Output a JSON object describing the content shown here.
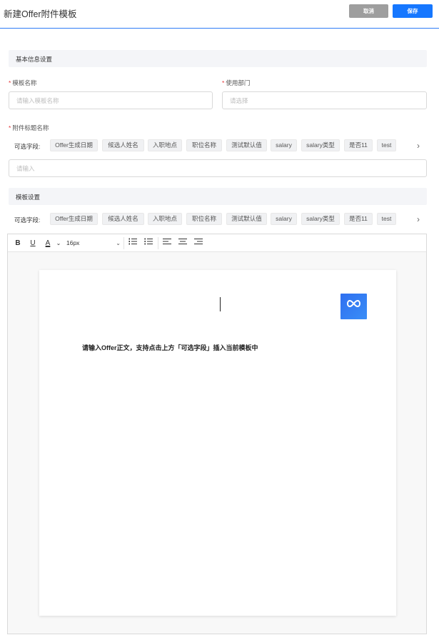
{
  "header": {
    "title": "新建Offer附件模板",
    "cancel_label": "取消",
    "save_label": "保存"
  },
  "basic_section": {
    "title": "基本信息设置",
    "template_name_label": "模板名称",
    "template_name_placeholder": "请输入模板名称",
    "department_label": "使用部门",
    "department_placeholder": "请选择",
    "attachment_title_label": "附件标题名称",
    "optional_fields_label": "可选字段:",
    "attachment_title_placeholder": "请输入"
  },
  "optional_fields": [
    "Offer生成日期",
    "候选人姓名",
    "入职地点",
    "职位名称",
    "测试默认值",
    "salary",
    "salary类型",
    "是否11",
    "test"
  ],
  "template_section": {
    "title": "模板设置",
    "optional_fields_label": "可选字段:"
  },
  "editor": {
    "bold_label": "B",
    "underline_label": "U",
    "font_color_label": "A",
    "font_size_value": "16px",
    "doc_text": "请输入Offer正文，支持点击上方「可选字段」插入当前模板中"
  },
  "colors": {
    "primary": "#1677ff",
    "cancel": "#9e9e9e",
    "required": "#e5383b"
  }
}
